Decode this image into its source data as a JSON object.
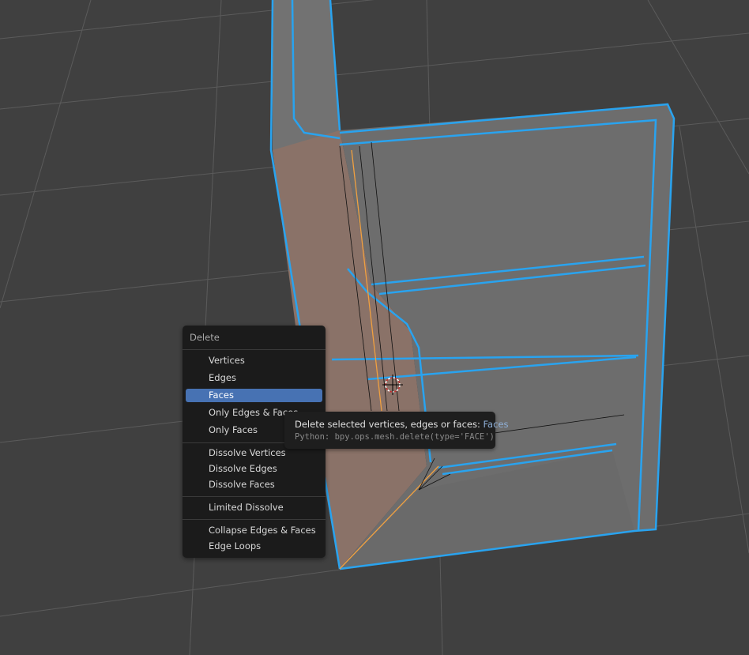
{
  "viewport": {
    "background_color": "#404040",
    "grid_color": "#5a5a5a",
    "mesh_face_color": "#6e6e6e",
    "selected_face_color": "#8a7268",
    "selected_edge_color": "#29a3ef",
    "active_edge_color": "#f0a040"
  },
  "delete_menu": {
    "title": "Delete",
    "items": [
      {
        "label": "Vertices",
        "group": 1
      },
      {
        "label": "Edges",
        "group": 1
      },
      {
        "label": "Faces",
        "group": 1,
        "highlighted": true
      },
      {
        "label": "Only Edges & Faces",
        "group": 1
      },
      {
        "label": "Only Faces",
        "group": 1
      },
      {
        "label": "Dissolve Vertices",
        "group": 2
      },
      {
        "label": "Dissolve Edges",
        "group": 2
      },
      {
        "label": "Dissolve Faces",
        "group": 2
      },
      {
        "label": "Limited Dissolve",
        "group": 3
      },
      {
        "label": "Collapse Edges & Faces",
        "group": 4
      },
      {
        "label": "Edge Loops",
        "group": 4
      }
    ],
    "highlight_color": "#4772b3"
  },
  "tooltip": {
    "description": "Delete selected vertices, edges or faces:",
    "value": "Faces",
    "python": "Python: bpy.ops.mesh.delete(type='FACE')"
  }
}
